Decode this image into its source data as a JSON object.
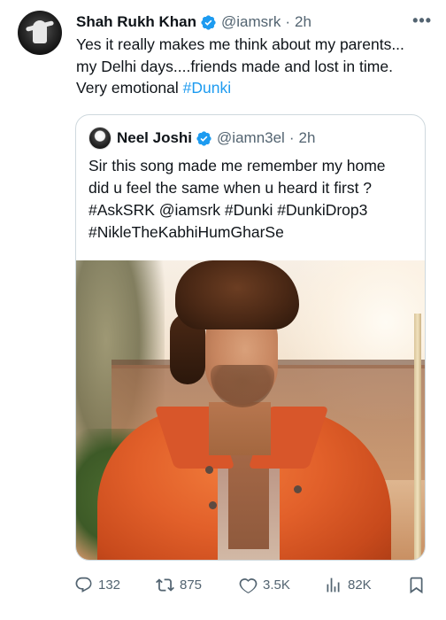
{
  "tweet": {
    "author_name": "Shah Rukh Khan",
    "author_handle": "@iamsrk",
    "separator": "·",
    "time": "2h",
    "more_label": "•••",
    "text_line1": "Yes it really makes me think about my parents...",
    "text_line2": "my Delhi days....friends made and lost in time.",
    "text_line3_plain": "Very emotional ",
    "text_line3_hashtag": "#Dunki"
  },
  "quote": {
    "author_name": "Neel Joshi",
    "author_handle": "@iamn3el",
    "separator": "·",
    "time": "2h",
    "line1": "Sir this song made me remember my home",
    "line2": "did u feel the same when u heard it first ?",
    "line3": "#AskSRK @iamsrk #Dunki #DunkiDrop3",
    "line4": "#NikleTheKabhiHumGharSe"
  },
  "actions": {
    "replies": "132",
    "retweets": "875",
    "likes": "3.5K",
    "views": "82K"
  },
  "colors": {
    "accent": "#1d9bf0",
    "muted": "#536471",
    "text": "#0f1419",
    "border": "#cfd9de"
  },
  "icons": [
    "verified-badge-icon",
    "more-icon",
    "reply-icon",
    "retweet-icon",
    "like-icon",
    "views-icon",
    "bookmark-icon"
  ]
}
